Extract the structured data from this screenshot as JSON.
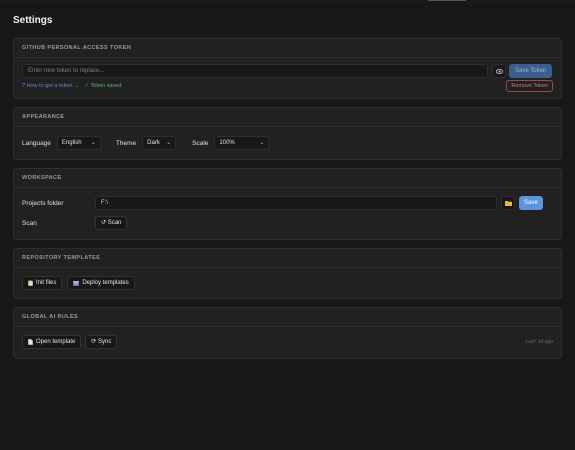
{
  "page_title": "Settings",
  "token": {
    "section_title": "GITHUB PERSONAL ACCESS TOKEN",
    "input_placeholder": "Enter new token to replace...",
    "reveal_icon": "eye-icon",
    "save_label": "Save Token",
    "help_link": "? How to get a token →",
    "status": "✓ Token saved",
    "remove_label": "Remove Token"
  },
  "appearance": {
    "section_title": "APPEARANCE",
    "language_label": "Language",
    "language_value": "English",
    "theme_label": "Theme",
    "theme_value": "Dark",
    "scale_label": "Scale",
    "scale_value": "100%"
  },
  "workspace": {
    "section_title": "WORKSPACE",
    "projects_label": "Projects folder",
    "projects_value": "F:\\",
    "folder_icon": "folder-icon",
    "save_label": "Save",
    "scan_label_text": "Scan",
    "scan_button": "↺ Scan"
  },
  "templates": {
    "section_title": "REPOSITORY TEMPLATES",
    "init_button": "Init files",
    "init_icon": "clipboard-icon",
    "deploy_button": "Deploy templates",
    "deploy_icon": "package-icon"
  },
  "ai_rules": {
    "section_title": "GLOBAL AI RULES",
    "open_button": "Open template",
    "open_icon": "document-icon",
    "sync_button": "⟳ Sync",
    "last_sync": "Last: 1d ago"
  },
  "colors": {
    "background": "#181818",
    "card": "#212121",
    "accent": "#5b93e0",
    "success": "#5bb86a",
    "danger": "#d57a7a"
  }
}
